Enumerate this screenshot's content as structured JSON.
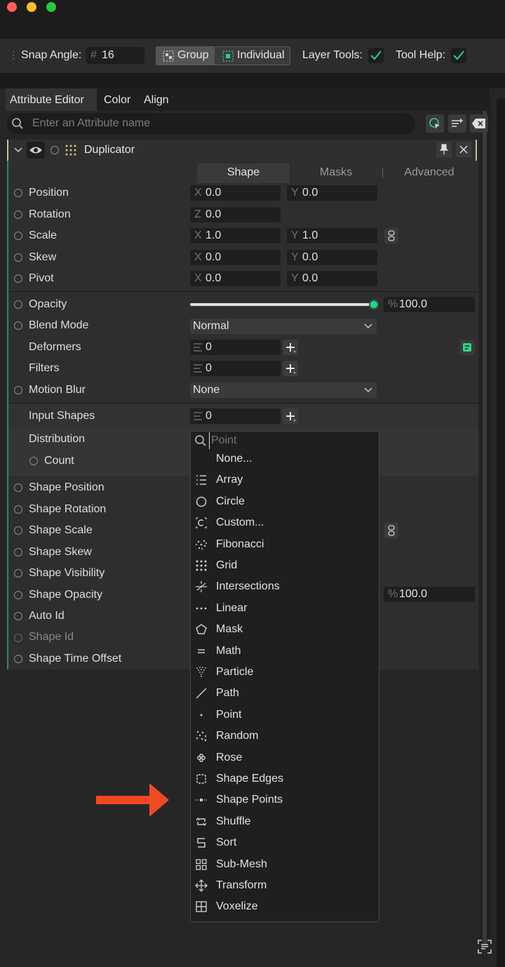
{
  "toolbar": {
    "snap_angle_label": "Snap Angle:",
    "snap_angle_prefix": "#",
    "snap_angle_value": "16",
    "group_label": "Group",
    "individual_label": "Individual",
    "layer_tools_label": "Layer Tools:",
    "tool_help_label": "Tool Help:"
  },
  "tabs": [
    "Attribute Editor",
    "Color",
    "Align"
  ],
  "search": {
    "placeholder": "Enter an Attribute name"
  },
  "node": {
    "title": "Duplicator"
  },
  "subtabs": [
    "Shape",
    "Masks",
    "Advanced"
  ],
  "attributes": {
    "position": {
      "label": "Position",
      "x": "0.0",
      "y": "0.0"
    },
    "rotation": {
      "label": "Rotation",
      "z": "0.0"
    },
    "scale": {
      "label": "Scale",
      "x": "1.0",
      "y": "1.0"
    },
    "skew": {
      "label": "Skew",
      "x": "0.0",
      "y": "0.0"
    },
    "pivot": {
      "label": "Pivot",
      "x": "0.0",
      "y": "0.0"
    },
    "opacity": {
      "label": "Opacity",
      "prefix": "%",
      "value": "100.0",
      "fraction": 1.0
    },
    "blend_mode": {
      "label": "Blend Mode",
      "value": "Normal"
    },
    "deformers": {
      "label": "Deformers",
      "count": "0"
    },
    "filters": {
      "label": "Filters",
      "count": "0"
    },
    "motion_blur": {
      "label": "Motion Blur",
      "value": "None"
    },
    "input_shapes": {
      "label": "Input Shapes",
      "count": "0"
    },
    "distribution": {
      "label": "Distribution"
    },
    "count": {
      "label": "Count"
    },
    "shape_position": {
      "label": "Shape Position"
    },
    "shape_rotation": {
      "label": "Shape Rotation"
    },
    "shape_scale": {
      "label": "Shape Scale"
    },
    "shape_skew": {
      "label": "Shape Skew"
    },
    "shape_visibility": {
      "label": "Shape Visibility"
    },
    "shape_opacity": {
      "label": "Shape Opacity",
      "prefix": "%",
      "value": "100.0"
    },
    "auto_id": {
      "label": "Auto Id"
    },
    "shape_id": {
      "label": "Shape Id"
    },
    "shape_time_offset": {
      "label": "Shape Time Offset"
    }
  },
  "axis_labels": {
    "x": "X",
    "y": "Y",
    "z": "Z"
  },
  "dropdown": {
    "search_placeholder": "Point",
    "items": [
      {
        "label": "None...",
        "icon": "none"
      },
      {
        "label": "Array",
        "icon": "array-icon"
      },
      {
        "label": "Circle",
        "icon": "circle-icon"
      },
      {
        "label": "Custom...",
        "icon": "custom-icon"
      },
      {
        "label": "Fibonacci",
        "icon": "fibonacci-icon"
      },
      {
        "label": "Grid",
        "icon": "grid-icon"
      },
      {
        "label": "Intersections",
        "icon": "intersections-icon"
      },
      {
        "label": "Linear",
        "icon": "linear-icon"
      },
      {
        "label": "Mask",
        "icon": "mask-icon"
      },
      {
        "label": "Math",
        "icon": "math-icon"
      },
      {
        "label": "Particle",
        "icon": "particle-icon"
      },
      {
        "label": "Path",
        "icon": "path-icon"
      },
      {
        "label": "Point",
        "icon": "point-icon"
      },
      {
        "label": "Random",
        "icon": "random-icon"
      },
      {
        "label": "Rose",
        "icon": "rose-icon"
      },
      {
        "label": "Shape Edges",
        "icon": "shape-edges-icon"
      },
      {
        "label": "Shape Points",
        "icon": "shape-points-icon"
      },
      {
        "label": "Shuffle",
        "icon": "shuffle-icon"
      },
      {
        "label": "Sort",
        "icon": "sort-icon"
      },
      {
        "label": "Sub-Mesh",
        "icon": "sub-mesh-icon"
      },
      {
        "label": "Transform",
        "icon": "transform-icon"
      },
      {
        "label": "Voxelize",
        "icon": "voxelize-icon"
      }
    ]
  },
  "colors": {
    "accent_green": "#2fd08a",
    "annotation_arrow": "#f04a25",
    "node_header_border": "#c9c08a"
  }
}
